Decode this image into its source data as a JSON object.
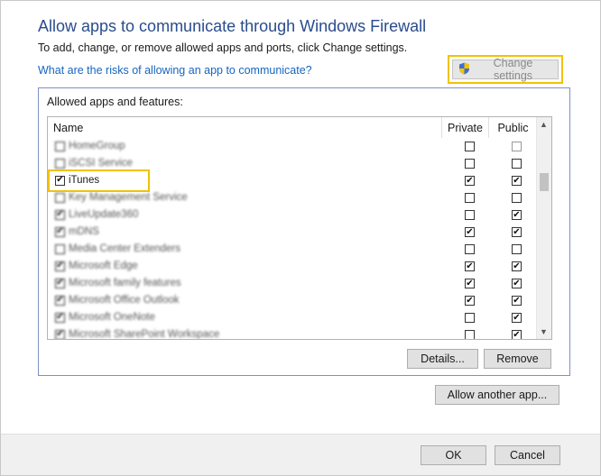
{
  "header": {
    "title": "Allow apps to communicate through Windows Firewall",
    "subtitle": "To add, change, or remove allowed apps and ports, click Change settings.",
    "risks_link": "What are the risks of allowing an app to communicate?",
    "change_settings_label": "Change settings"
  },
  "group": {
    "label": "Allowed apps and features:"
  },
  "table": {
    "columns": {
      "name": "Name",
      "private": "Private",
      "public": "Public"
    },
    "rows": [
      {
        "name": "HomeGroup",
        "checked": false,
        "private": false,
        "public": false,
        "blurred": true
      },
      {
        "name": "iSCSI Service",
        "checked": false,
        "private": false,
        "public": false,
        "blurred": true
      },
      {
        "name": "iTunes",
        "checked": true,
        "private": true,
        "public": true,
        "blurred": false
      },
      {
        "name": "Key Management Service",
        "checked": false,
        "private": false,
        "public": false,
        "blurred": true
      },
      {
        "name": "LiveUpdate360",
        "checked": true,
        "private": false,
        "public": true,
        "blurred": true
      },
      {
        "name": "mDNS",
        "checked": true,
        "private": true,
        "public": true,
        "blurred": true
      },
      {
        "name": "Media Center Extenders",
        "checked": false,
        "private": false,
        "public": false,
        "blurred": true
      },
      {
        "name": "Microsoft Edge",
        "checked": true,
        "private": true,
        "public": true,
        "blurred": true
      },
      {
        "name": "Microsoft family features",
        "checked": true,
        "private": true,
        "public": true,
        "blurred": true
      },
      {
        "name": "Microsoft Office Outlook",
        "checked": true,
        "private": true,
        "public": true,
        "blurred": true
      },
      {
        "name": "Microsoft OneNote",
        "checked": true,
        "private": false,
        "public": true,
        "blurred": true
      },
      {
        "name": "Microsoft SharePoint Workspace",
        "checked": true,
        "private": false,
        "public": true,
        "blurred": true
      }
    ]
  },
  "buttons": {
    "details": "Details...",
    "remove": "Remove",
    "allow_another": "Allow another app...",
    "ok": "OK",
    "cancel": "Cancel"
  }
}
